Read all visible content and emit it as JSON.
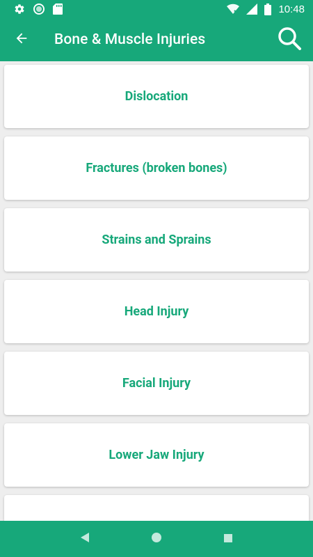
{
  "colors": {
    "primary": "#17a87a",
    "background": "#eeeeee",
    "card": "#ffffff",
    "accent_text": "#17a87a"
  },
  "status_bar": {
    "time": "10:48",
    "icons": [
      "settings-icon",
      "circle-icon",
      "sd-card-icon",
      "wifi-off-icon",
      "signal-icon",
      "battery-icon"
    ]
  },
  "app_bar": {
    "title": "Bone & Muscle Injuries",
    "back_icon": "arrow-back-icon",
    "search_icon": "search-icon"
  },
  "items": [
    {
      "label": "Dislocation"
    },
    {
      "label": "Fractures (broken bones)"
    },
    {
      "label": "Strains and Sprains"
    },
    {
      "label": "Head Injury"
    },
    {
      "label": "Facial Injury"
    },
    {
      "label": "Lower Jaw Injury"
    },
    {
      "label": ""
    }
  ],
  "nav_bar": {
    "icons": [
      "back-triangle-icon",
      "home-circle-icon",
      "recents-square-icon"
    ]
  }
}
